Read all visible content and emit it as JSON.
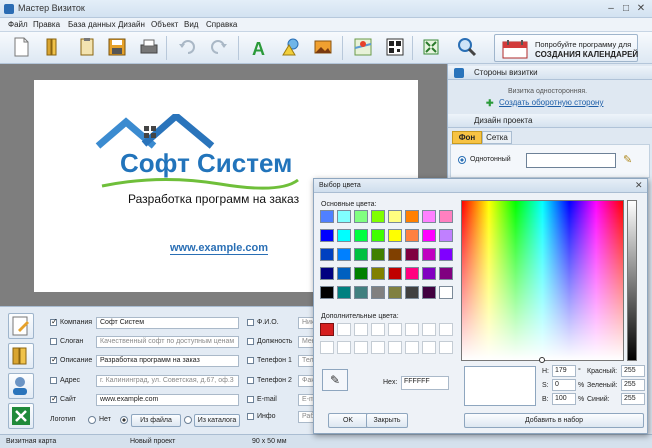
{
  "window": {
    "title": "Мастер Визиток"
  },
  "menu": [
    "Файл",
    "Правка",
    "База данных",
    "Дизайн",
    "Объект",
    "Вид",
    "Справка"
  ],
  "promo": {
    "line1": "Попробуйте программу для",
    "line2": "СОЗДАНИЯ КАЛЕНДАРЕЙ"
  },
  "card": {
    "company": "Софт Систем",
    "slogan": "Разработка программ на заказ",
    "site": "www.example.com"
  },
  "panel": {
    "sides_title": "Стороны визитки",
    "sides_info": "Визитка односторонняя.",
    "sides_link": "Создать оборотную сторону",
    "design_title": "Дизайн проекта",
    "tabs": [
      "Фон",
      "Сетка"
    ],
    "fill_option": "Однотонный"
  },
  "form": {
    "rows": [
      {
        "label": "Компания",
        "checked": true,
        "value": "Софт Систем",
        "placeholder": false
      },
      {
        "label": "Слоган",
        "checked": false,
        "value": "Качественный софт по доступным ценам",
        "placeholder": true
      },
      {
        "label": "Описание",
        "checked": true,
        "value": "Разработка программ на заказ",
        "placeholder": false
      },
      {
        "label": "Адрес",
        "checked": false,
        "value": "г. Калининград, ул. Советская, д.67, оф.3",
        "placeholder": true
      },
      {
        "label": "Сайт",
        "checked": true,
        "value": "www.example.com",
        "placeholder": false
      }
    ],
    "right_rows": [
      {
        "label": "Ф.И.О.",
        "value": "Ники"
      },
      {
        "label": "Должность",
        "value": "Мене"
      },
      {
        "label": "Телефон 1",
        "value": "Тел."
      },
      {
        "label": "Телефон 2",
        "value": "Факс"
      },
      {
        "label": "E-mail",
        "value": "E-ma"
      },
      {
        "label": "Инфо",
        "value": "Рабо"
      }
    ],
    "logo_label": "Логотип",
    "logo_options": [
      "Нет",
      "Из файла",
      "Из каталога"
    ]
  },
  "status": {
    "left": "Визитная карта",
    "mid": "Новый проект",
    "size": "90 x 50 мм"
  },
  "dialog": {
    "title": "Выбор цвета",
    "basic_label": "Основные цвета:",
    "custom_label": "Дополнительные цвета:",
    "hex_label": "Hex:",
    "hex_value": "FFFFFF",
    "h_label": "H:",
    "h_value": "179",
    "h_unit": "°",
    "s_label": "S:",
    "s_value": "0",
    "s_unit": "%",
    "b_label": "B:",
    "b_value": "100",
    "b_unit": "%",
    "r_label": "Красный:",
    "r_value": "255",
    "g_label": "Зеленый:",
    "g_value": "255",
    "bl_label": "Синий:",
    "bl_value": "255",
    "ok": "OK",
    "close": "Закрыть",
    "add": "Добавить в набор",
    "basic_colors": [
      "#4f80ff",
      "#80ffff",
      "#80ff80",
      "#80ff00",
      "#ffff80",
      "#ff8000",
      "#ff80ff",
      "#ff80c0",
      "#0000ff",
      "#00ffff",
      "#00ff40",
      "#40ff00",
      "#ffff00",
      "#ff8040",
      "#ff00ff",
      "#c080ff",
      "#0040c0",
      "#0080ff",
      "#00c040",
      "#408000",
      "#804000",
      "#800040",
      "#c000c0",
      "#8000ff",
      "#000080",
      "#0060c0",
      "#008000",
      "#808000",
      "#c00000",
      "#ff0080",
      "#8000c0",
      "#800080",
      "#000000",
      "#008080",
      "#408080",
      "#808080",
      "#808040",
      "#404040",
      "#400040",
      "#ffffff"
    ]
  }
}
